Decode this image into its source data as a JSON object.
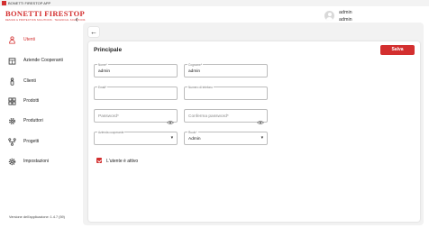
{
  "window": {
    "title": "BONETTI FIRESTOP APP"
  },
  "brand": {
    "name": "BONETTI FIRESTOP",
    "tagline": "DESIGN & PROTECTION SOLUTIONS · TECHNICAL SOLUTIONS"
  },
  "sidebar": {
    "items": [
      {
        "label": "Utenti",
        "icon": "users-icon",
        "active": true
      },
      {
        "label": "Aziende Cooperanti",
        "icon": "building-icon",
        "active": false
      },
      {
        "label": "Clienti",
        "icon": "person-icon",
        "active": false
      },
      {
        "label": "Prodotti",
        "icon": "grid-icon",
        "active": false
      },
      {
        "label": "Produttori",
        "icon": "gear-icon",
        "active": false
      },
      {
        "label": "Progetti",
        "icon": "network-icon",
        "active": false
      },
      {
        "label": "Impostazioni",
        "icon": "settings-icon",
        "active": false
      }
    ],
    "version": "Versione dell'applicazione: 1.4.7 (59)"
  },
  "header": {
    "user_name": "admin",
    "user_role": "admin"
  },
  "form": {
    "title": "Principale",
    "save_label": "Salva",
    "fields": {
      "nome": {
        "label": "Nome*",
        "value": "admin"
      },
      "cognome": {
        "label": "Cognome*",
        "value": "admin"
      },
      "email": {
        "label": "Email*",
        "value": ""
      },
      "telefono": {
        "label": "Numero di telefono",
        "value": ""
      },
      "password": {
        "placeholder": "Password*"
      },
      "conferma": {
        "placeholder": "Conferma password*"
      },
      "azienda": {
        "label": "Azienda cooperante",
        "value": ""
      },
      "ruolo": {
        "label": "Ruolo*",
        "value": "Admin"
      }
    },
    "active_checkbox_label": "L'utente è attivo",
    "active_checked": true
  },
  "colors": {
    "accent": "#d32f2f",
    "panel": "#f2f2f2"
  }
}
